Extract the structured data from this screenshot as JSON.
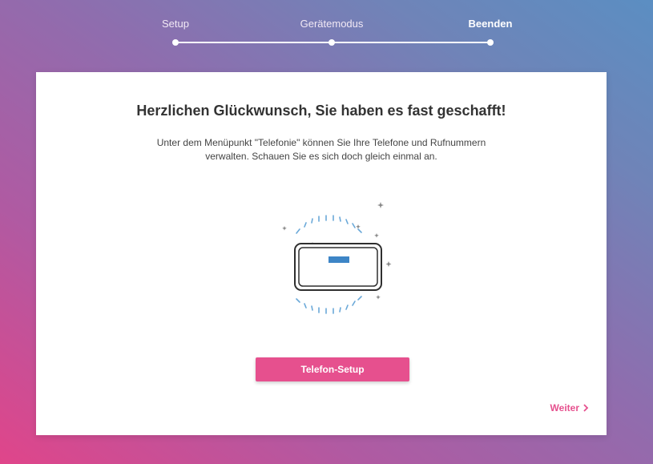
{
  "stepper": {
    "steps": [
      {
        "label": "Setup",
        "state": "done"
      },
      {
        "label": "Gerätemodus",
        "state": "done"
      },
      {
        "label": "Beenden",
        "state": "active"
      }
    ]
  },
  "card": {
    "title": "Herzlichen Glückwunsch, Sie haben es fast geschafft!",
    "description": "Unter dem Menüpunkt \"Telefonie\" können Sie Ihre Telefone und Rufnummern verwalten. Schauen Sie es sich doch gleich einmal an.",
    "illustration_icon": "router-device-icon",
    "primary_button": "Telefon-Setup",
    "next_link": "Weiter",
    "next_icon": "chevron-right-icon"
  },
  "colors": {
    "accent": "#e6508e",
    "device_screen": "#3d85c6",
    "sparkle_lines": "#6aa8d8"
  }
}
